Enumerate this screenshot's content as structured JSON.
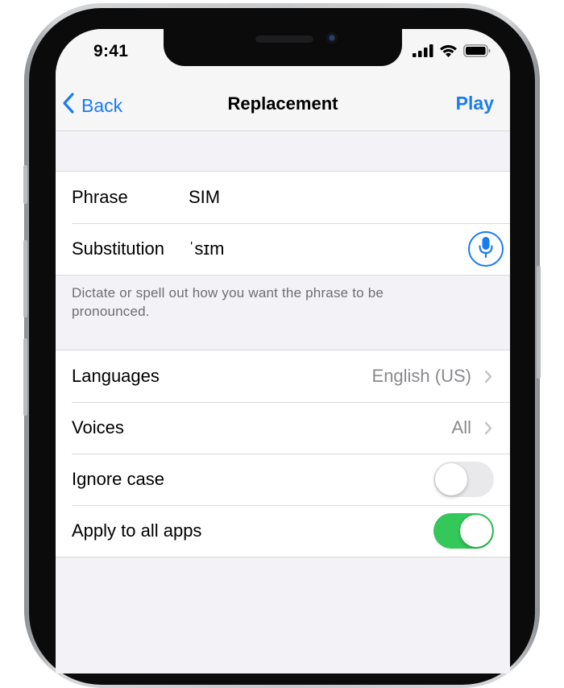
{
  "status_bar": {
    "time": "9:41"
  },
  "nav": {
    "back_label": "Back",
    "title": "Replacement",
    "action_label": "Play"
  },
  "phrase_group": {
    "phrase_label": "Phrase",
    "phrase_value": "SIM",
    "substitution_label": "Substitution",
    "substitution_value": "ˈsɪm",
    "footer": "Dictate or spell out how you want the phrase to be pronounced."
  },
  "settings": {
    "languages_label": "Languages",
    "languages_value": "English (US)",
    "voices_label": "Voices",
    "voices_value": "All",
    "ignore_case_label": "Ignore case",
    "ignore_case_on": false,
    "apply_all_label": "Apply to all apps",
    "apply_all_on": true
  },
  "colors": {
    "accent": "#1a7cf2",
    "toggle_on": "#34c759",
    "toggle_off": "#e9e9eb",
    "grouped_bg": "#f2f2f7"
  },
  "icons": [
    "back-chevron-icon",
    "microphone-icon",
    "chevron-right-icon",
    "signal-icon",
    "wifi-icon",
    "battery-icon"
  ]
}
